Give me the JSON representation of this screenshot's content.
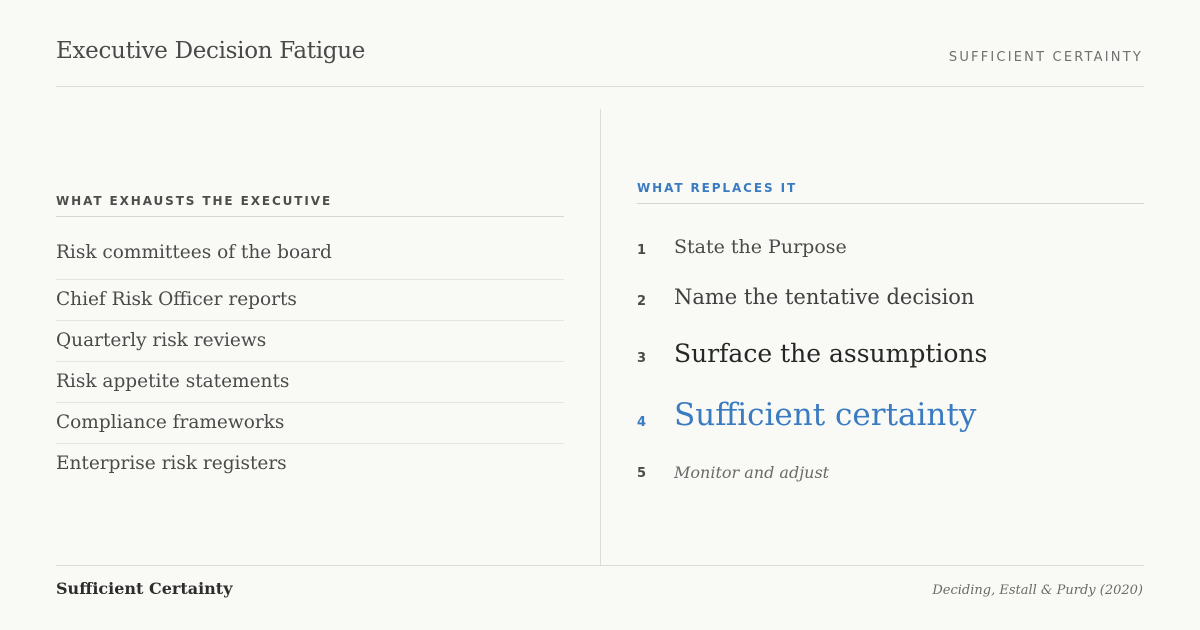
{
  "header": {
    "title": "Executive Decision Fatigue",
    "tag": "SUFFICIENT CERTAINTY"
  },
  "left": {
    "label": "WHAT EXHAUSTS THE EXECUTIVE",
    "items": [
      "Risk committees of the board",
      "Chief Risk Officer reports",
      "Quarterly risk reviews",
      "Risk appetite statements",
      "Compliance frameworks",
      "Enterprise risk registers"
    ]
  },
  "right": {
    "label": "WHAT REPLACES IT",
    "steps": [
      {
        "num": "1",
        "text": "State the Purpose"
      },
      {
        "num": "2",
        "text": "Name the tentative decision"
      },
      {
        "num": "3",
        "text": "Surface the assumptions"
      },
      {
        "num": "4",
        "text": "Sufficient certainty"
      },
      {
        "num": "5",
        "text": "Monitor and adjust"
      }
    ]
  },
  "footer": {
    "left": "Sufficient Certainty",
    "right": "Deciding, Estall & Purdy (2020)"
  },
  "colors": {
    "accent": "#3a7bc2",
    "background": "#f9f9f5"
  }
}
